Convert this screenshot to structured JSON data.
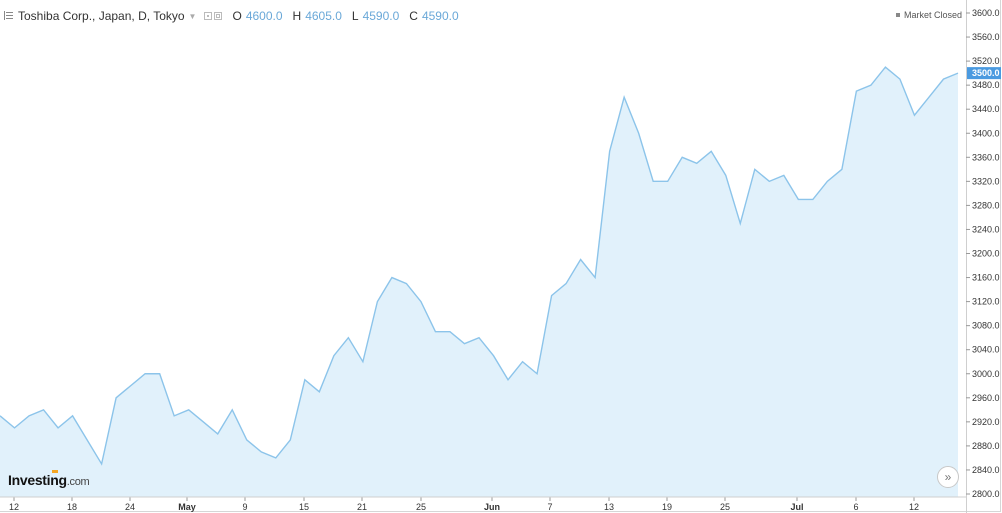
{
  "header": {
    "title": "Toshiba Corp., Japan, D, Tokyo",
    "ohlc": [
      {
        "label": "O",
        "value": "4600.0"
      },
      {
        "label": "H",
        "value": "4605.0"
      },
      {
        "label": "L",
        "value": "4590.0"
      },
      {
        "label": "C",
        "value": "4590.0"
      }
    ],
    "market_status": "Market Closed"
  },
  "logo": {
    "name": "Investing",
    "suffix": ".com"
  },
  "colors": {
    "line": "#8cc4ea",
    "fill": "#e1f1fb",
    "price_tag": "#4a9ae0"
  },
  "icons": {
    "menu": "menu-icon",
    "scroll": "double-chevron-right-icon"
  },
  "chart_data": {
    "type": "area",
    "x_tick_labels": [
      "12",
      "18",
      "24",
      "May",
      "9",
      "15",
      "21",
      "25",
      "Jun",
      "7",
      "13",
      "19",
      "25",
      "Jul",
      "6",
      "12"
    ],
    "y_tick_labels": [
      "2800.0",
      "2840.0",
      "2880.0",
      "2920.0",
      "2960.0",
      "3000.0",
      "3040.0",
      "3080.0",
      "3120.0",
      "3160.0",
      "3200.0",
      "3240.0",
      "3280.0",
      "3320.0",
      "3360.0",
      "3400.0",
      "3440.0",
      "3480.0",
      "3520.0",
      "3560.0",
      "3600.0"
    ],
    "ylim": [
      2800,
      3620
    ],
    "last_price": "3500.0",
    "values": [
      2930,
      2910,
      2930,
      2940,
      2910,
      2930,
      2890,
      2850,
      2960,
      2980,
      3000,
      3000,
      2930,
      2940,
      2920,
      2900,
      2940,
      2890,
      2870,
      2860,
      2890,
      2990,
      2970,
      3030,
      3060,
      3020,
      3120,
      3160,
      3150,
      3120,
      3070,
      3070,
      3050,
      3060,
      3030,
      2990,
      3020,
      3000,
      3130,
      3150,
      3190,
      3160,
      3370,
      3460,
      3400,
      3320,
      3320,
      3360,
      3350,
      3370,
      3330,
      3250,
      3340,
      3320,
      3330,
      3290,
      3290,
      3320,
      3340,
      3470,
      3480,
      3510,
      3490,
      3430,
      3460,
      3490,
      3500
    ]
  }
}
